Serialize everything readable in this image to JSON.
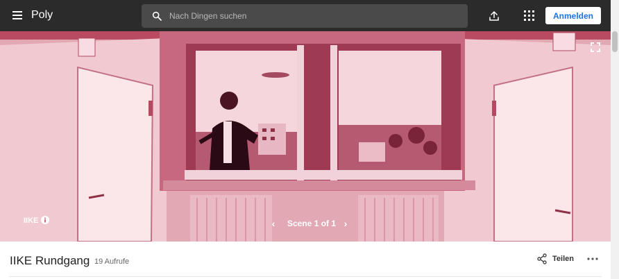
{
  "app": {
    "title": "Poly"
  },
  "header": {
    "search_placeholder": "Nach Dingen suchen",
    "signin_label": "Anmelden"
  },
  "viewer": {
    "scene_title": "IIKE",
    "scene_nav": "Scene 1 of 1",
    "tint_color": "#c04a64"
  },
  "asset": {
    "title": "IIKE Rundgang",
    "views": "19 Aufrufe",
    "share_label": "Teilen"
  },
  "icons": [
    "menu-icon",
    "search-icon",
    "upload-icon",
    "apps-icon",
    "fullscreen-icon",
    "chevron-left-icon",
    "chevron-right-icon",
    "info-icon",
    "share-icon",
    "more-icon"
  ]
}
